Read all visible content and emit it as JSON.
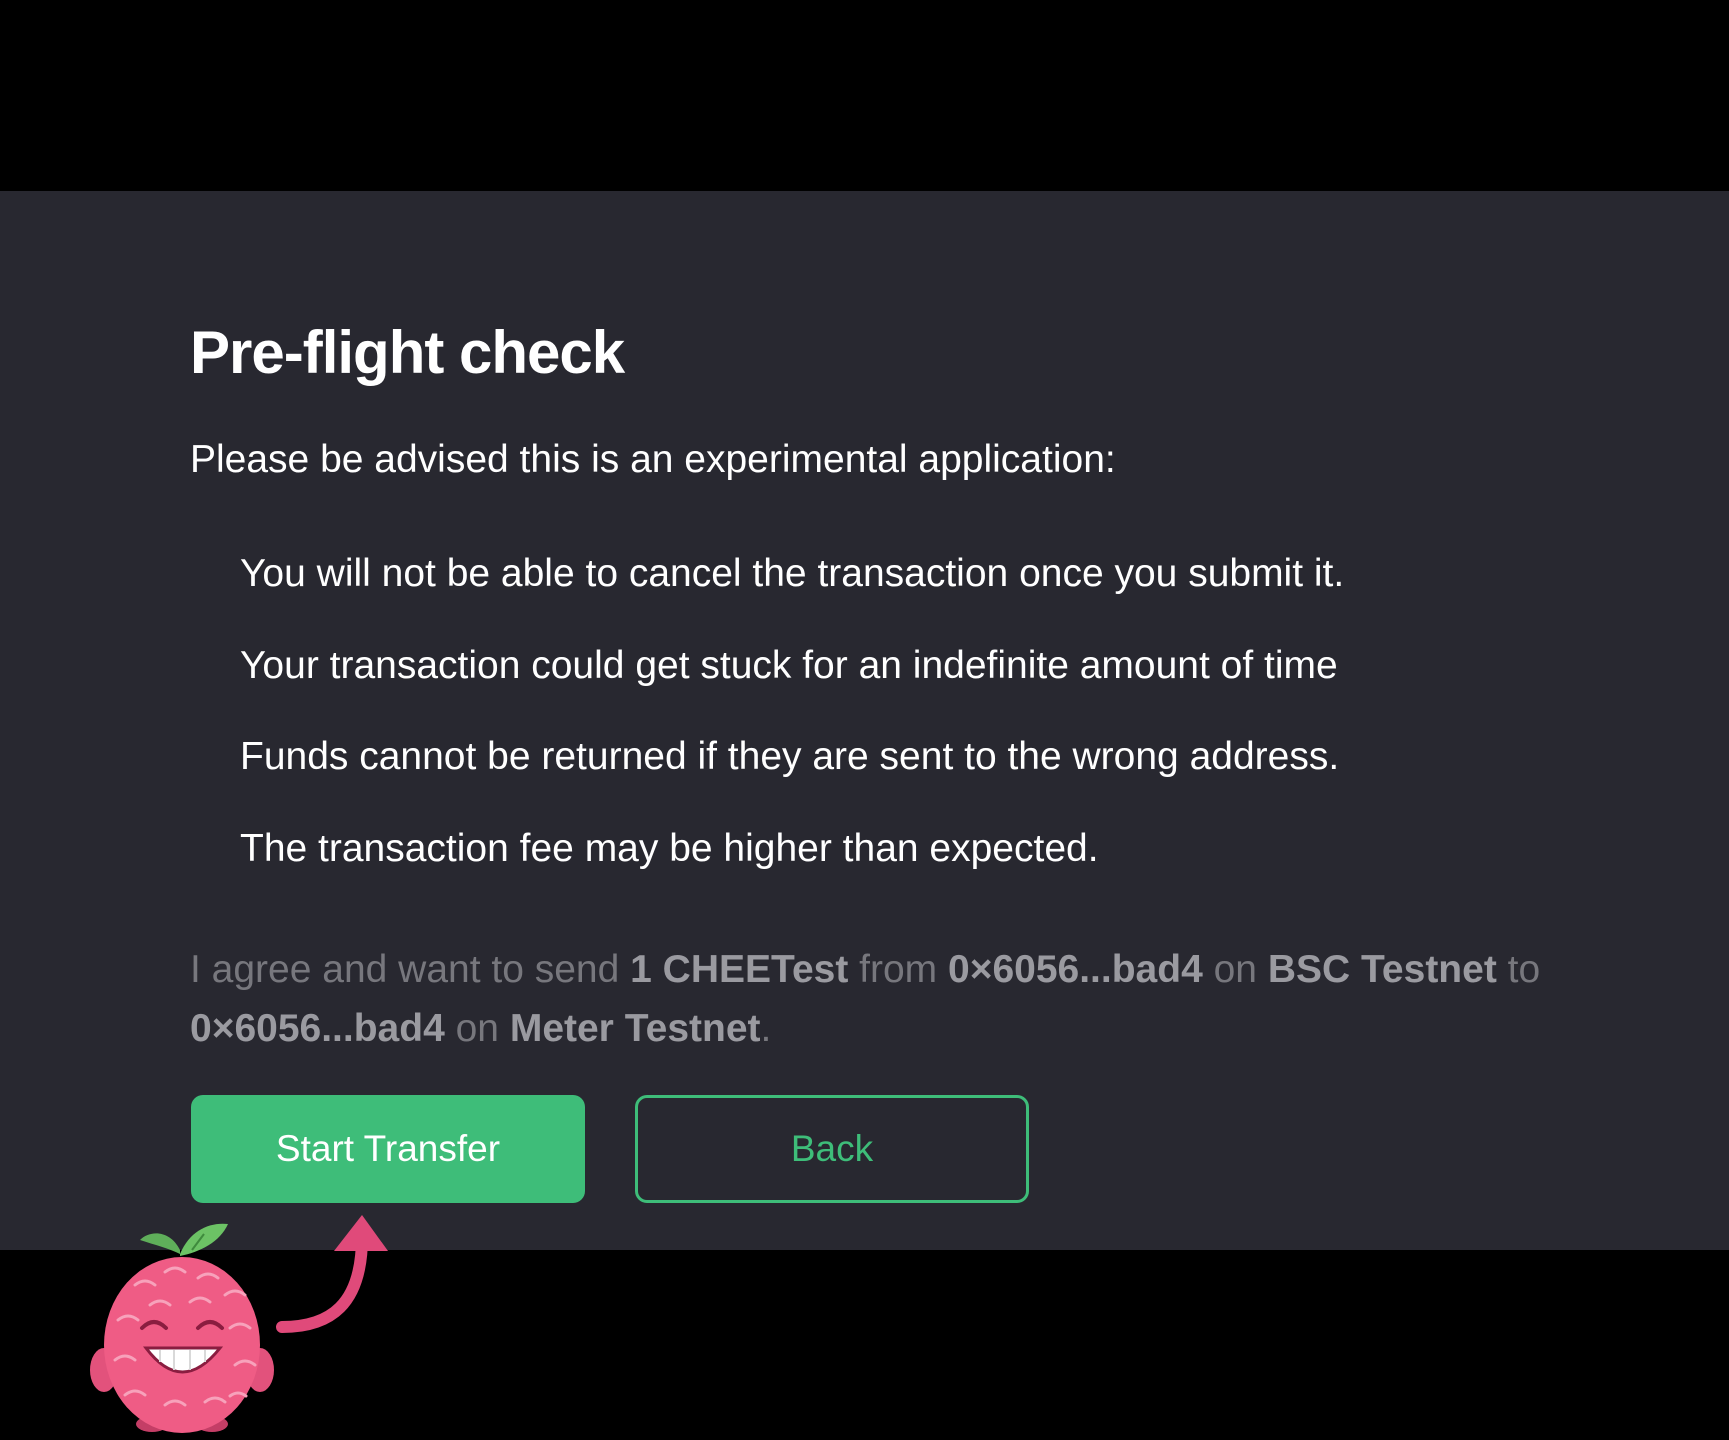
{
  "dialog": {
    "title": "Pre-flight check",
    "intro": "Please be advised this is an experimental application:",
    "warnings": [
      "You will not be able to cancel the transaction once you submit it.",
      "Your transaction could get stuck for an indefinite amount of time",
      "Funds cannot be returned if they are sent to the wrong address.",
      "The transaction fee may be higher than expected."
    ],
    "agreement": {
      "prefix": "I agree and want to send ",
      "amount": "1 CHEETest",
      "from_word": " from ",
      "from_address": "0×6056...bad4",
      "on_word_1": " on ",
      "from_network": "BSC Testnet",
      "to_word": " to ",
      "to_address": "0×6056...bad4",
      "on_word_2": " on ",
      "to_network": "Meter Testnet",
      "suffix": "."
    },
    "buttons": {
      "start_transfer": "Start Transfer",
      "back": "Back"
    }
  },
  "colors": {
    "panel_background": "#282830",
    "accent_green": "#3ebd79",
    "arrow_pink": "#e04a7a",
    "mascot_pink": "#ef5c85"
  },
  "icons": {
    "mascot": "raspberry-mascot-icon",
    "arrow": "curved-arrow-icon"
  }
}
